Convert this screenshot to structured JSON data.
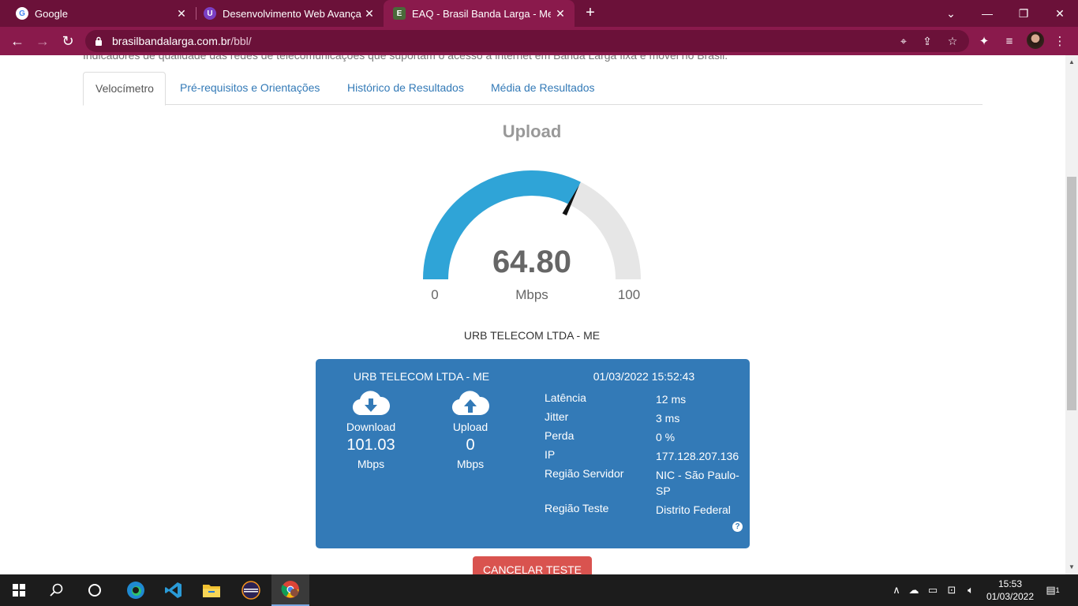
{
  "browser": {
    "tabs": [
      {
        "title": "Google",
        "favicon": "google-icon"
      },
      {
        "title": "Desenvolvimento Web Avançado",
        "favicon": "shield-u-icon"
      },
      {
        "title": "EAQ - Brasil Banda Larga - Meça",
        "favicon": "eaq-icon"
      }
    ],
    "url_host": "brasilbandalarga.com.br",
    "url_path": "/bbl/"
  },
  "page": {
    "intro_text": "Indicadores de qualidade das redes de telecomunicações que suportam o acesso à internet em Banda Larga fixa e móvel no Brasil.",
    "tabs": [
      "Velocímetro",
      "Pré-requisitos e Orientações",
      "Histórico de Resultados",
      "Média de Resultados"
    ],
    "gauge": {
      "title": "Upload",
      "value": "64.80",
      "value_fraction": 0.648,
      "unit": "Mbps",
      "min": "0",
      "max": "100",
      "fill_color": "#2fa4d7",
      "track_color": "#e6e6e6"
    },
    "provider": "URB TELECOM LTDA - ME",
    "result": {
      "provider": "URB TELECOM LTDA - ME",
      "datetime": "01/03/2022 15:52:43",
      "download": {
        "label": "Download",
        "value": "101.03",
        "unit": "Mbps"
      },
      "upload": {
        "label": "Upload",
        "value": "0",
        "unit": "Mbps"
      },
      "stats": [
        {
          "key": "Latência",
          "value": "12 ms"
        },
        {
          "key": "Jitter",
          "value": "3 ms"
        },
        {
          "key": "Perda",
          "value": "0 %"
        },
        {
          "key": "IP",
          "value": "177.128.207.136"
        },
        {
          "key": "Região Servidor",
          "value": "NIC - São Paulo-SP"
        },
        {
          "key": "Região Teste",
          "value": "Distrito Federal"
        }
      ],
      "help_glyph": "?"
    },
    "cancel_button": "CANCELAR TESTE"
  },
  "taskbar": {
    "time": "15:53",
    "date": "01/03/2022",
    "notifications": "1"
  },
  "colors": {
    "chrome_dark": "#6b1139",
    "chrome_light": "#8a1a4c",
    "card_blue": "#337ab7",
    "cancel_red": "#d9534f"
  }
}
